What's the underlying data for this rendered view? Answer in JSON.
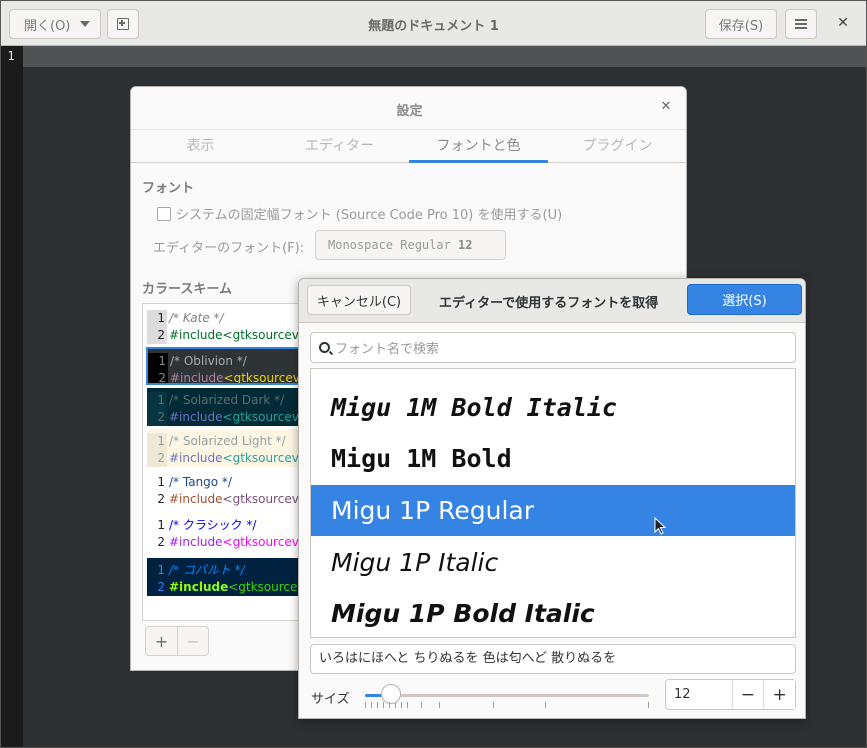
{
  "headerbar": {
    "open_label": "開く(O)",
    "title": "無題のドキュメント 1",
    "save_label": "保存(S)"
  },
  "editor": {
    "line_number": "1"
  },
  "prefs": {
    "title": "設定",
    "tabs": [
      {
        "label": "表示"
      },
      {
        "label": "エディター"
      },
      {
        "label": "フォントと色"
      },
      {
        "label": "プラグイン"
      }
    ],
    "font_section": "フォント",
    "use_system_font": "システムの固定幅フォント (Source Code Pro 10) を使用する(U)",
    "editor_font_label": "エディターのフォント(F):",
    "editor_font_name": "Monospace Regular ",
    "editor_font_size": "12",
    "color_scheme_section": "カラースキーム",
    "schemes": [
      {
        "l1": "/* Kate */",
        "l2a": "#include ",
        "l2b": "<gtksourcevi"
      },
      {
        "l1": "/* Oblivion */",
        "l2a": "#include ",
        "l2b": "<gtksourcevi"
      },
      {
        "l1": "/* Solarized Dark */",
        "l2a": "#include ",
        "l2b": "<gtksourcevi"
      },
      {
        "l1": "/* Solarized Light */",
        "l2a": "#include ",
        "l2b": "<gtksourcevi"
      },
      {
        "l1": "/* Tango */",
        "l2a": "#include ",
        "l2b": "<gtksourcevi"
      },
      {
        "l1": "/* クラシック */",
        "l2a": "#include ",
        "l2b": "<gtksourcevi"
      },
      {
        "l1": "/* コバルト */",
        "l2a": "#include ",
        "l2b": "<gtksourcev"
      }
    ],
    "line_num_1": "1",
    "line_num_2": "2",
    "add_label": "+",
    "remove_label": "−"
  },
  "chooser": {
    "cancel_label": "キャンセル(C)",
    "title": "エディターで使用するフォントを取得",
    "select_label": "選択(S)",
    "search_placeholder": "フォント名で検索",
    "fonts": [
      {
        "name": "Migu 1M Bold Italic"
      },
      {
        "name": "Migu 1M Bold"
      },
      {
        "name": "Migu 1P Regular"
      },
      {
        "name": "Migu 1P Italic"
      },
      {
        "name": "Migu 1P Bold Italic"
      }
    ],
    "selected_index": 2,
    "preview_text": "いろはにほへと ちりぬるを 色は匂へど 散りぬるを",
    "size_label": "サイズ",
    "size_value": "12",
    "slider_fraction": 0.09,
    "minus_label": "−",
    "plus_label": "+"
  },
  "colors": {
    "accent": "#3584e4"
  }
}
